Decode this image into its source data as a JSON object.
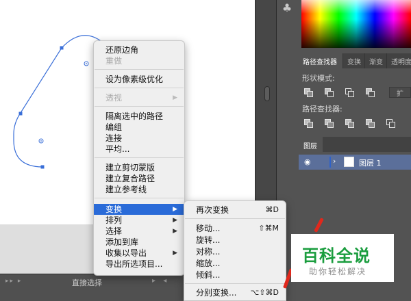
{
  "status_bar": {
    "nav": "▸▸ ▸",
    "tool_name": "直接选择",
    "arrows": "▸ ◂"
  },
  "side_icon": "clubs-icon",
  "color_panel": {
    "icon": "color-spectrum"
  },
  "pathfinder_panel": {
    "tabs": [
      "路径查找器",
      "变换",
      "渐变",
      "透明度"
    ],
    "shape_modes_label": "形状模式:",
    "expand_label": "扩",
    "pathfinders_label": "路径查找器:"
  },
  "layers_panel": {
    "tab": "图层",
    "layer_name": "图层 1",
    "eye_icon": "eye-icon",
    "selection_color": "#5b6f9a"
  },
  "context_menu": {
    "items": [
      {
        "label": "还原边角",
        "disabled": false
      },
      {
        "label": "重做",
        "disabled": true
      },
      {
        "label": "设为像素级优化",
        "disabled": false
      },
      {
        "label": "透视",
        "disabled": true,
        "arrow": "▶"
      },
      {
        "label": "隔离选中的路径",
        "disabled": false
      },
      {
        "label": "编组",
        "disabled": false
      },
      {
        "label": "连接",
        "disabled": false
      },
      {
        "label": "平均...",
        "disabled": false
      },
      {
        "label": "建立剪切蒙版",
        "disabled": false
      },
      {
        "label": "建立复合路径",
        "disabled": false
      },
      {
        "label": "建立参考线",
        "disabled": false
      },
      {
        "label": "变换",
        "disabled": false,
        "arrow": "▶",
        "highlighted": true
      },
      {
        "label": "排列",
        "disabled": false,
        "arrow": "▶"
      },
      {
        "label": "选择",
        "disabled": false,
        "arrow": "▶"
      },
      {
        "label": "添加到库",
        "disabled": false
      },
      {
        "label": "收集以导出",
        "disabled": false,
        "arrow": "▶"
      },
      {
        "label": "导出所选项目...",
        "disabled": false
      }
    ]
  },
  "transform_submenu": {
    "items": [
      {
        "label": "再次变换",
        "shortcut": "⌘D"
      },
      {
        "label": "移动...",
        "shortcut": "⇧⌘M"
      },
      {
        "label": "旋转...",
        "shortcut": ""
      },
      {
        "label": "对称...",
        "shortcut": ""
      },
      {
        "label": "缩放...",
        "shortcut": ""
      },
      {
        "label": "倾斜...",
        "shortcut": ""
      },
      {
        "label": "分别变换...",
        "shortcut": "⌥⇧⌘D"
      }
    ]
  },
  "watermark": {
    "main": "百科全说",
    "sub": "助你轻松解决",
    "color": "#1a9d3e"
  },
  "colors": {
    "highlight": "#2a6bd8",
    "path_stroke": "#3a6fd8",
    "annotation_red": "#e0281c"
  }
}
